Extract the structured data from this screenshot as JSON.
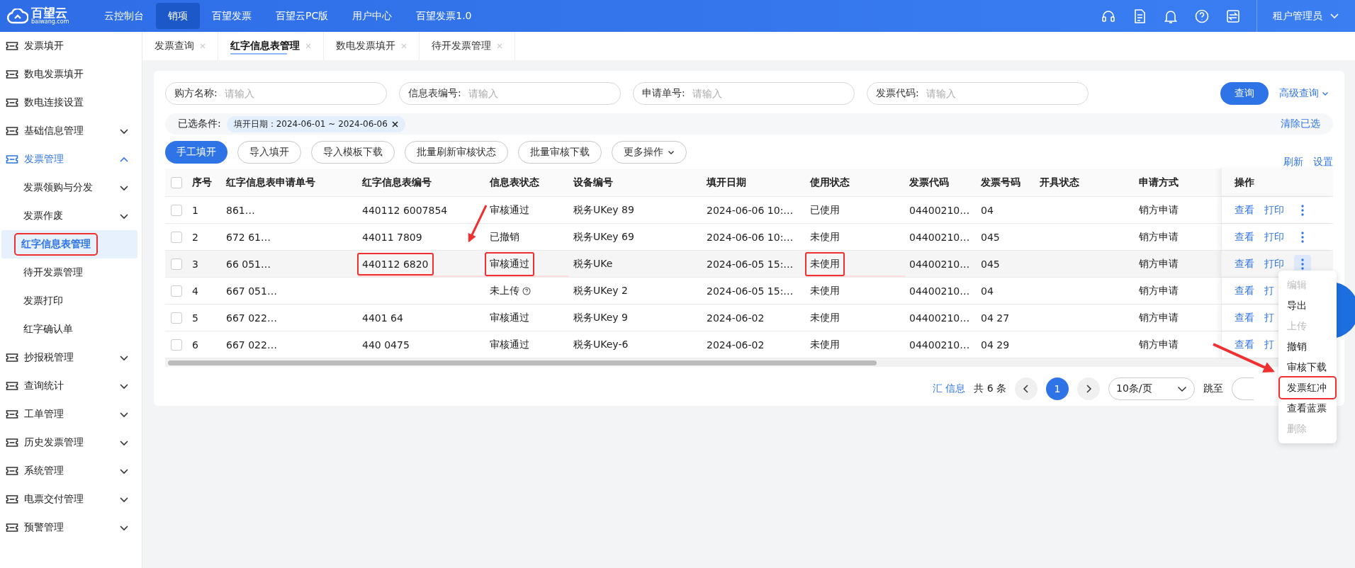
{
  "top_bar": {
    "logo": "百望云",
    "logo_sub": "baiwang.com",
    "nav": [
      {
        "label": "云控制台",
        "selected": false
      },
      {
        "label": "销项",
        "selected": true
      },
      {
        "label": "百望发票",
        "selected": false
      },
      {
        "label": "百望云PC版",
        "selected": false
      },
      {
        "label": "用户中心",
        "selected": false
      },
      {
        "label": "百望发票1.0",
        "selected": false
      }
    ],
    "user": "租户管理员"
  },
  "sidebar": {
    "items": [
      {
        "label": "发票填开",
        "kind": "link",
        "selected": false
      },
      {
        "label": "数电发票填开",
        "kind": "link",
        "selected": false
      },
      {
        "label": "数电连接设置",
        "kind": "link",
        "selected": false
      },
      {
        "label": "基础信息管理",
        "kind": "group",
        "expanded": false,
        "selected": false
      },
      {
        "label": "发票管理",
        "kind": "group",
        "expanded": true,
        "selected": true,
        "children": [
          {
            "label": "发票领购与分发",
            "kind": "group",
            "expanded": false,
            "selected": false,
            "annotated": false
          },
          {
            "label": "发票作废",
            "kind": "group",
            "expanded": false,
            "selected": false,
            "annotated": false
          },
          {
            "label": "红字信息表管理",
            "kind": "link",
            "selected": true,
            "annotated": true
          },
          {
            "label": "待开发票管理",
            "kind": "link",
            "selected": false,
            "annotated": false
          },
          {
            "label": "发票打印",
            "kind": "link",
            "selected": false,
            "annotated": false
          },
          {
            "label": "红字确认单",
            "kind": "link",
            "selected": false,
            "annotated": false
          }
        ]
      },
      {
        "label": "抄报税管理",
        "kind": "group",
        "expanded": false,
        "selected": false
      },
      {
        "label": "查询统计",
        "kind": "group",
        "expanded": false,
        "selected": false
      },
      {
        "label": "工单管理",
        "kind": "group",
        "expanded": false,
        "selected": false
      },
      {
        "label": "历史发票管理",
        "kind": "group",
        "expanded": false,
        "selected": false
      },
      {
        "label": "系统管理",
        "kind": "group",
        "expanded": false,
        "selected": false
      },
      {
        "label": "电票交付管理",
        "kind": "group",
        "expanded": false,
        "selected": false
      },
      {
        "label": "预警管理",
        "kind": "group",
        "expanded": false,
        "selected": false
      }
    ]
  },
  "tabs": [
    {
      "label": "发票查询",
      "selected": false
    },
    {
      "label": "红字信息表管理",
      "selected": true
    },
    {
      "label": "数电发票填开",
      "selected": false
    },
    {
      "label": "待开发票管理",
      "selected": false
    }
  ],
  "filters": [
    {
      "label": "购方名称:",
      "placeholder": "请输入"
    },
    {
      "label": "信息表编号:",
      "placeholder": "请输入"
    },
    {
      "label": "申请单号:",
      "placeholder": "请输入"
    },
    {
      "label": "发票代码:",
      "placeholder": "请输入"
    }
  ],
  "query_button": "查询",
  "advanced_query": "高级查询",
  "conditions": {
    "label": "已选条件:",
    "chips": [
      "填开日期：2024-06-01 ~ 2024-06-06"
    ],
    "clear": "清除已选"
  },
  "actions": [
    {
      "label": "手工填开",
      "kind": "primary"
    },
    {
      "label": "导入填开",
      "kind": "plain"
    },
    {
      "label": "导入模板下载",
      "kind": "plain"
    },
    {
      "label": "批量刷新审核状态",
      "kind": "plain"
    },
    {
      "label": "批量审核下载",
      "kind": "plain"
    },
    {
      "label": "更多操作",
      "kind": "dropdown"
    }
  ],
  "table_tools": [
    "刷新",
    "设置"
  ],
  "table": {
    "all_selected": false,
    "columns": [
      "序号",
      "红字信息表申请单号",
      "红字信息表编号",
      "信息表状态",
      "设备编号",
      "填开日期",
      "使用状态",
      "发票代码",
      "发票号码",
      "开具状态",
      "申请方式",
      "操作"
    ],
    "rows": [
      {
        "selected": false,
        "status_help": false,
        "menu_open": false,
        "cells": [
          {
            "text": "1",
            "annotated": false
          },
          {
            "text": "861…",
            "annotated": false
          },
          {
            "text": "440112 6007854",
            "annotated": false
          },
          {
            "text": "审核通过",
            "annotated": false
          },
          {
            "text": "税务UKey 89",
            "annotated": false
          },
          {
            "text": "2024-06-06 10:…",
            "annotated": false
          },
          {
            "text": "已使用",
            "annotated": false
          },
          {
            "text": "04400210…",
            "annotated": false
          },
          {
            "text": "04",
            "annotated": false
          },
          {
            "annotated": false
          },
          {
            "text": "销方申请",
            "annotated": false
          }
        ],
        "ops": [
          "查看",
          "打印"
        ]
      },
      {
        "selected": false,
        "status_help": false,
        "menu_open": false,
        "cells": [
          {
            "text": "2",
            "annotated": false
          },
          {
            "text": "672 61…",
            "annotated": false
          },
          {
            "text": "44011 7809",
            "annotated": false
          },
          {
            "text": "已撤销",
            "annotated": false
          },
          {
            "text": "税务UKey 69",
            "annotated": false
          },
          {
            "text": "2024-06-06 10:…",
            "annotated": false
          },
          {
            "text": "未使用",
            "annotated": false
          },
          {
            "text": "04400210…",
            "annotated": false
          },
          {
            "text": "045",
            "annotated": false
          },
          {
            "annotated": false
          },
          {
            "text": "销方申请",
            "annotated": false
          }
        ],
        "ops": [
          "查看",
          "打印"
        ]
      },
      {
        "selected": false,
        "status_help": false,
        "menu_open": true,
        "cells": [
          {
            "text": "3",
            "annotated": false
          },
          {
            "text": "66 051…",
            "annotated": false
          },
          {
            "text": "440112 6820",
            "annotated": true
          },
          {
            "text": "审核通过",
            "annotated": true
          },
          {
            "text": "税务UKe",
            "annotated": false
          },
          {
            "text": "2024-06-05 15:…",
            "annotated": false
          },
          {
            "text": "未使用",
            "annotated": true
          },
          {
            "text": "04400210…",
            "annotated": false
          },
          {
            "text": "045",
            "annotated": false
          },
          {
            "annotated": false
          },
          {
            "text": "销方申请",
            "annotated": false
          }
        ],
        "ops": [
          "查看",
          "打印"
        ]
      },
      {
        "selected": false,
        "status_help": true,
        "menu_open": false,
        "cells": [
          {
            "text": "4",
            "annotated": false
          },
          {
            "text": "667 051…",
            "annotated": false
          },
          {
            "annotated": false
          },
          {
            "text": "未上传",
            "annotated": false
          },
          {
            "text": "税务UKey 2",
            "annotated": false
          },
          {
            "text": "2024-06-05 15:…",
            "annotated": false
          },
          {
            "text": "未使用",
            "annotated": false
          },
          {
            "text": "04400210…",
            "annotated": false
          },
          {
            "text": "04",
            "annotated": false
          },
          {
            "annotated": false
          },
          {
            "text": "销方申请",
            "annotated": false
          }
        ],
        "ops": [
          "查看",
          "打"
        ]
      },
      {
        "selected": false,
        "status_help": false,
        "menu_open": false,
        "cells": [
          {
            "text": "5",
            "annotated": false
          },
          {
            "text": "667 022…",
            "annotated": false
          },
          {
            "text": "4401 64",
            "annotated": false
          },
          {
            "text": "审核通过",
            "annotated": false
          },
          {
            "text": "税务UKey 9",
            "annotated": false
          },
          {
            "text": "2024-06-02",
            "annotated": false
          },
          {
            "text": "未使用",
            "annotated": false
          },
          {
            "text": "04400210…",
            "annotated": false
          },
          {
            "text": "04 27",
            "annotated": false
          },
          {
            "annotated": false
          },
          {
            "text": "销方申请",
            "annotated": false
          }
        ],
        "ops": [
          "查看",
          "打"
        ]
      },
      {
        "selected": false,
        "status_help": false,
        "menu_open": false,
        "cells": [
          {
            "text": "6",
            "annotated": false
          },
          {
            "text": "667 022…",
            "annotated": false
          },
          {
            "text": "440 0475",
            "annotated": false
          },
          {
            "text": "审核通过",
            "annotated": false
          },
          {
            "text": "税务UKey-6",
            "annotated": false
          },
          {
            "text": "2024-06-02",
            "annotated": false
          },
          {
            "text": "未使用",
            "annotated": false
          },
          {
            "text": "04400210…",
            "annotated": false
          },
          {
            "text": "04 29",
            "annotated": false
          },
          {
            "annotated": false
          },
          {
            "text": "销方申请",
            "annotated": false
          }
        ],
        "ops": [
          "查看",
          "打"
        ]
      }
    ]
  },
  "pager": {
    "summary": "汇 信息",
    "total": "共 6 条",
    "pages": [
      {
        "label": "1",
        "selected": true
      }
    ],
    "page_size": "10条/页",
    "jump": "跳至"
  },
  "row_menu": [
    {
      "label": "编辑",
      "disabled": true,
      "annotated": false
    },
    {
      "label": "导出",
      "disabled": false,
      "annotated": false
    },
    {
      "label": "上传",
      "disabled": true,
      "annotated": false
    },
    {
      "label": "撤销",
      "disabled": false,
      "annotated": false
    },
    {
      "label": "审核下载",
      "disabled": false,
      "annotated": false
    },
    {
      "label": "发票红冲",
      "disabled": false,
      "annotated": true
    },
    {
      "label": "查看蓝票",
      "disabled": false,
      "annotated": false
    },
    {
      "label": "删除",
      "disabled": true,
      "annotated": false
    }
  ]
}
